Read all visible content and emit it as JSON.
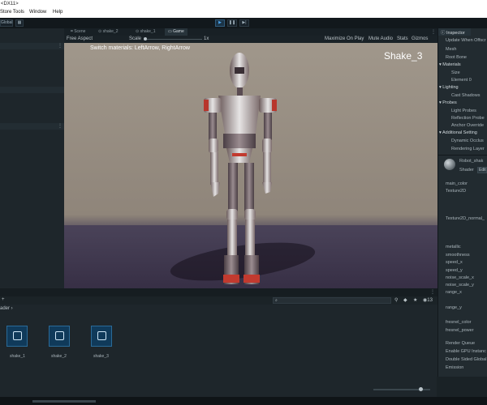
{
  "titlebar": {
    "title": "<DX11>"
  },
  "menu": {
    "items": [
      "Store Tools",
      "Window",
      "Help"
    ]
  },
  "toolbar": {
    "left_label": "Global"
  },
  "scene_tabs": [
    "Scene",
    "shake_2",
    "shake_1",
    "Game"
  ],
  "game_bar": {
    "aspect": "Free Aspect",
    "scale_label": "Scale",
    "scale_value": "1x",
    "right_items": [
      "Maximize On Play",
      "Mute Audio",
      "Stats",
      "Gizmos"
    ]
  },
  "game_view": {
    "hint": "Switch materials: LeftArrow, RightArrow",
    "label": "Shake_3",
    "colors": {
      "backdrop": "#8f857a",
      "floor": "#3f3850"
    }
  },
  "project": {
    "breadcrumb": "ader",
    "assets": [
      "shake_1",
      "shake_2",
      "shake_3"
    ],
    "count_badge": "13"
  },
  "inspector": {
    "tab": "Inspector",
    "rows_top": [
      "Update When Offscr",
      "Mesh",
      "Root Bone"
    ],
    "materials": {
      "title": "Materials",
      "items": [
        "Size",
        "Element 0"
      ]
    },
    "lighting": {
      "title": "Lighting",
      "items": [
        "Cast Shadows"
      ]
    },
    "probes": {
      "title": "Probes",
      "items": [
        "Light Probes",
        "Reflection Probe",
        "Anchor Override"
      ]
    },
    "additional": {
      "title": "Additional Setting",
      "items": [
        "Dynamic Occlus",
        "Rendering Layer"
      ]
    },
    "material_name": "Robot_shak",
    "shader_label": "Shader",
    "shader_btn": "Edit",
    "props": [
      "main_color",
      "Texture2D",
      "Texture2D_normal_",
      "metallic",
      "smoothness",
      "speed_x",
      "speed_y",
      "noise_scale_x",
      "noise_scale_y",
      "range_x",
      "range_y",
      "fresnel_color",
      "fresnel_power",
      "Render Queue",
      "Enable GPU Instanc",
      "Double Sided Global",
      "Emission"
    ]
  },
  "accent": "#3f9ee8"
}
